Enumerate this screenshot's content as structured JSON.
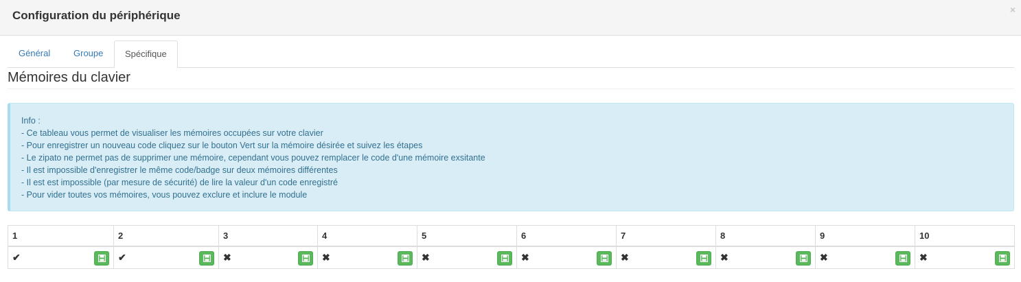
{
  "modal": {
    "title": "Configuration du périphérique",
    "close_glyph": "×"
  },
  "tabs": [
    {
      "label": "Général"
    },
    {
      "label": "Groupe"
    },
    {
      "label": "Spécifique",
      "active": true
    }
  ],
  "section": {
    "title": "Mémoires du clavier"
  },
  "info": {
    "lines": [
      "Info :",
      "- Ce tableau vous permet de visualiser les mémoires occupées sur votre clavier",
      "- Pour enregistrer un nouveau code cliquez sur le bouton Vert sur la mémoire désirée et suivez les étapes",
      "- Le zipato ne permet pas de supprimer une mémoire, cependant vous pouvez remplacer le code d'une mémoire exsitante",
      "- Il est impossible d'enregistrer le même code/badge sur deux mémoires différentes",
      "- Il est est impossible (par mesure de sécurité) de lire la valeur d'un code enregistré",
      "- Pour vider toutes vos mémoires, vous pouvez exclure et inclure le module"
    ]
  },
  "memories": {
    "headers": [
      "1",
      "2",
      "3",
      "4",
      "5",
      "6",
      "7",
      "8",
      "9",
      "10"
    ],
    "status": [
      {
        "icon": "check-icon",
        "glyph": "✔"
      },
      {
        "icon": "check-icon",
        "glyph": "✔"
      },
      {
        "icon": "cross-icon",
        "glyph": "✖"
      },
      {
        "icon": "cross-icon",
        "glyph": "✖"
      },
      {
        "icon": "cross-icon",
        "glyph": "✖"
      },
      {
        "icon": "cross-icon",
        "glyph": "✖"
      },
      {
        "icon": "cross-icon",
        "glyph": "✖"
      },
      {
        "icon": "cross-icon",
        "glyph": "✖"
      },
      {
        "icon": "cross-icon",
        "glyph": "✖"
      },
      {
        "icon": "cross-icon",
        "glyph": "✖"
      }
    ],
    "save_icon": "floppy-disk-icon"
  },
  "colors": {
    "info_bg": "#d9edf7",
    "info_text": "#31708f",
    "save_button": "#5cb85c",
    "link": "#337ab7"
  }
}
